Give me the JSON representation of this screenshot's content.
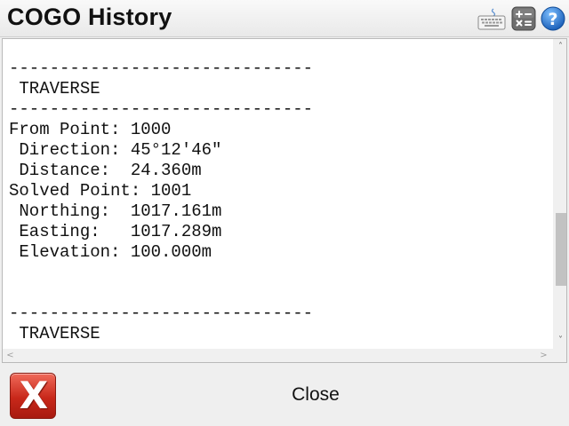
{
  "window": {
    "title": "COGO History"
  },
  "toolbar": {
    "keyboard_icon": "keyboard-icon",
    "calculator_icon": "calculator-icon",
    "help_icon": "help-icon",
    "help_glyph": "?"
  },
  "report": {
    "lines": [
      "------------------------------",
      " TRAVERSE",
      "------------------------------",
      "From Point: 1000",
      " Direction: 45°12'46\"",
      " Distance:  24.360m",
      "Solved Point: 1001",
      " Northing:  1017.161m",
      " Easting:   1017.289m",
      " Elevation: 100.000m",
      "",
      "",
      "------------------------------",
      " TRAVERSE"
    ]
  },
  "scrollbars": {
    "up_arrow": "˄",
    "down_arrow": "˅",
    "left_arrow": "<",
    "right_arrow": ">"
  },
  "bottom": {
    "close_icon": "close-x-icon",
    "close_glyph": "X",
    "close_label": "Close"
  },
  "colors": {
    "close_icon_red": "#c8281a",
    "help_blue": "#1a6fc8"
  }
}
